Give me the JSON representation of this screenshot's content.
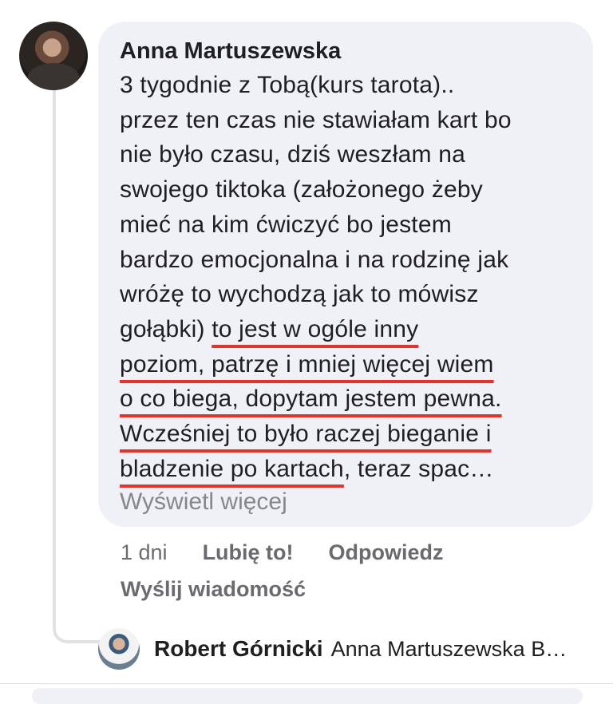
{
  "comment": {
    "author": "Anna Martuszewska",
    "text_lines": [
      "3 tygodnie z Tobą(kurs tarota)..",
      "przez ten czas nie stawiałam kart bo",
      "nie było czasu, dziś weszłam na",
      "swojego tiktoka (założonego żeby",
      "mieć na kim ćwiczyć bo jestem",
      "bardzo emocjonalna i na rodzinę jak",
      "wróżę to wychodzą jak to mówisz"
    ],
    "line8_plain": "gołąbki) ",
    "line8_underlined": "to jest w ogóle inny",
    "line9_underlined": "poziom, patrzę i mniej więcej wiem",
    "line10_underlined": "o co biega, dopytam jestem pewna.",
    "line11_underlined": "Wcześniej to było raczej bieganie i",
    "line12_underlined": "bladzenie po kartach",
    "line12_plain": ", teraz spac…",
    "see_more": "Wyświetl więcej",
    "time": "1 dni",
    "like_label": "Lubię to!",
    "reply_label": "Odpowiedz",
    "message_label": "Wyślij wiadomość"
  },
  "reply": {
    "author": "Robert Górnicki",
    "preview": "Anna Martuszewska B…"
  },
  "colors": {
    "bubble": "#f0f1f6",
    "underline": "#e5322b",
    "muted": "#86868d"
  }
}
